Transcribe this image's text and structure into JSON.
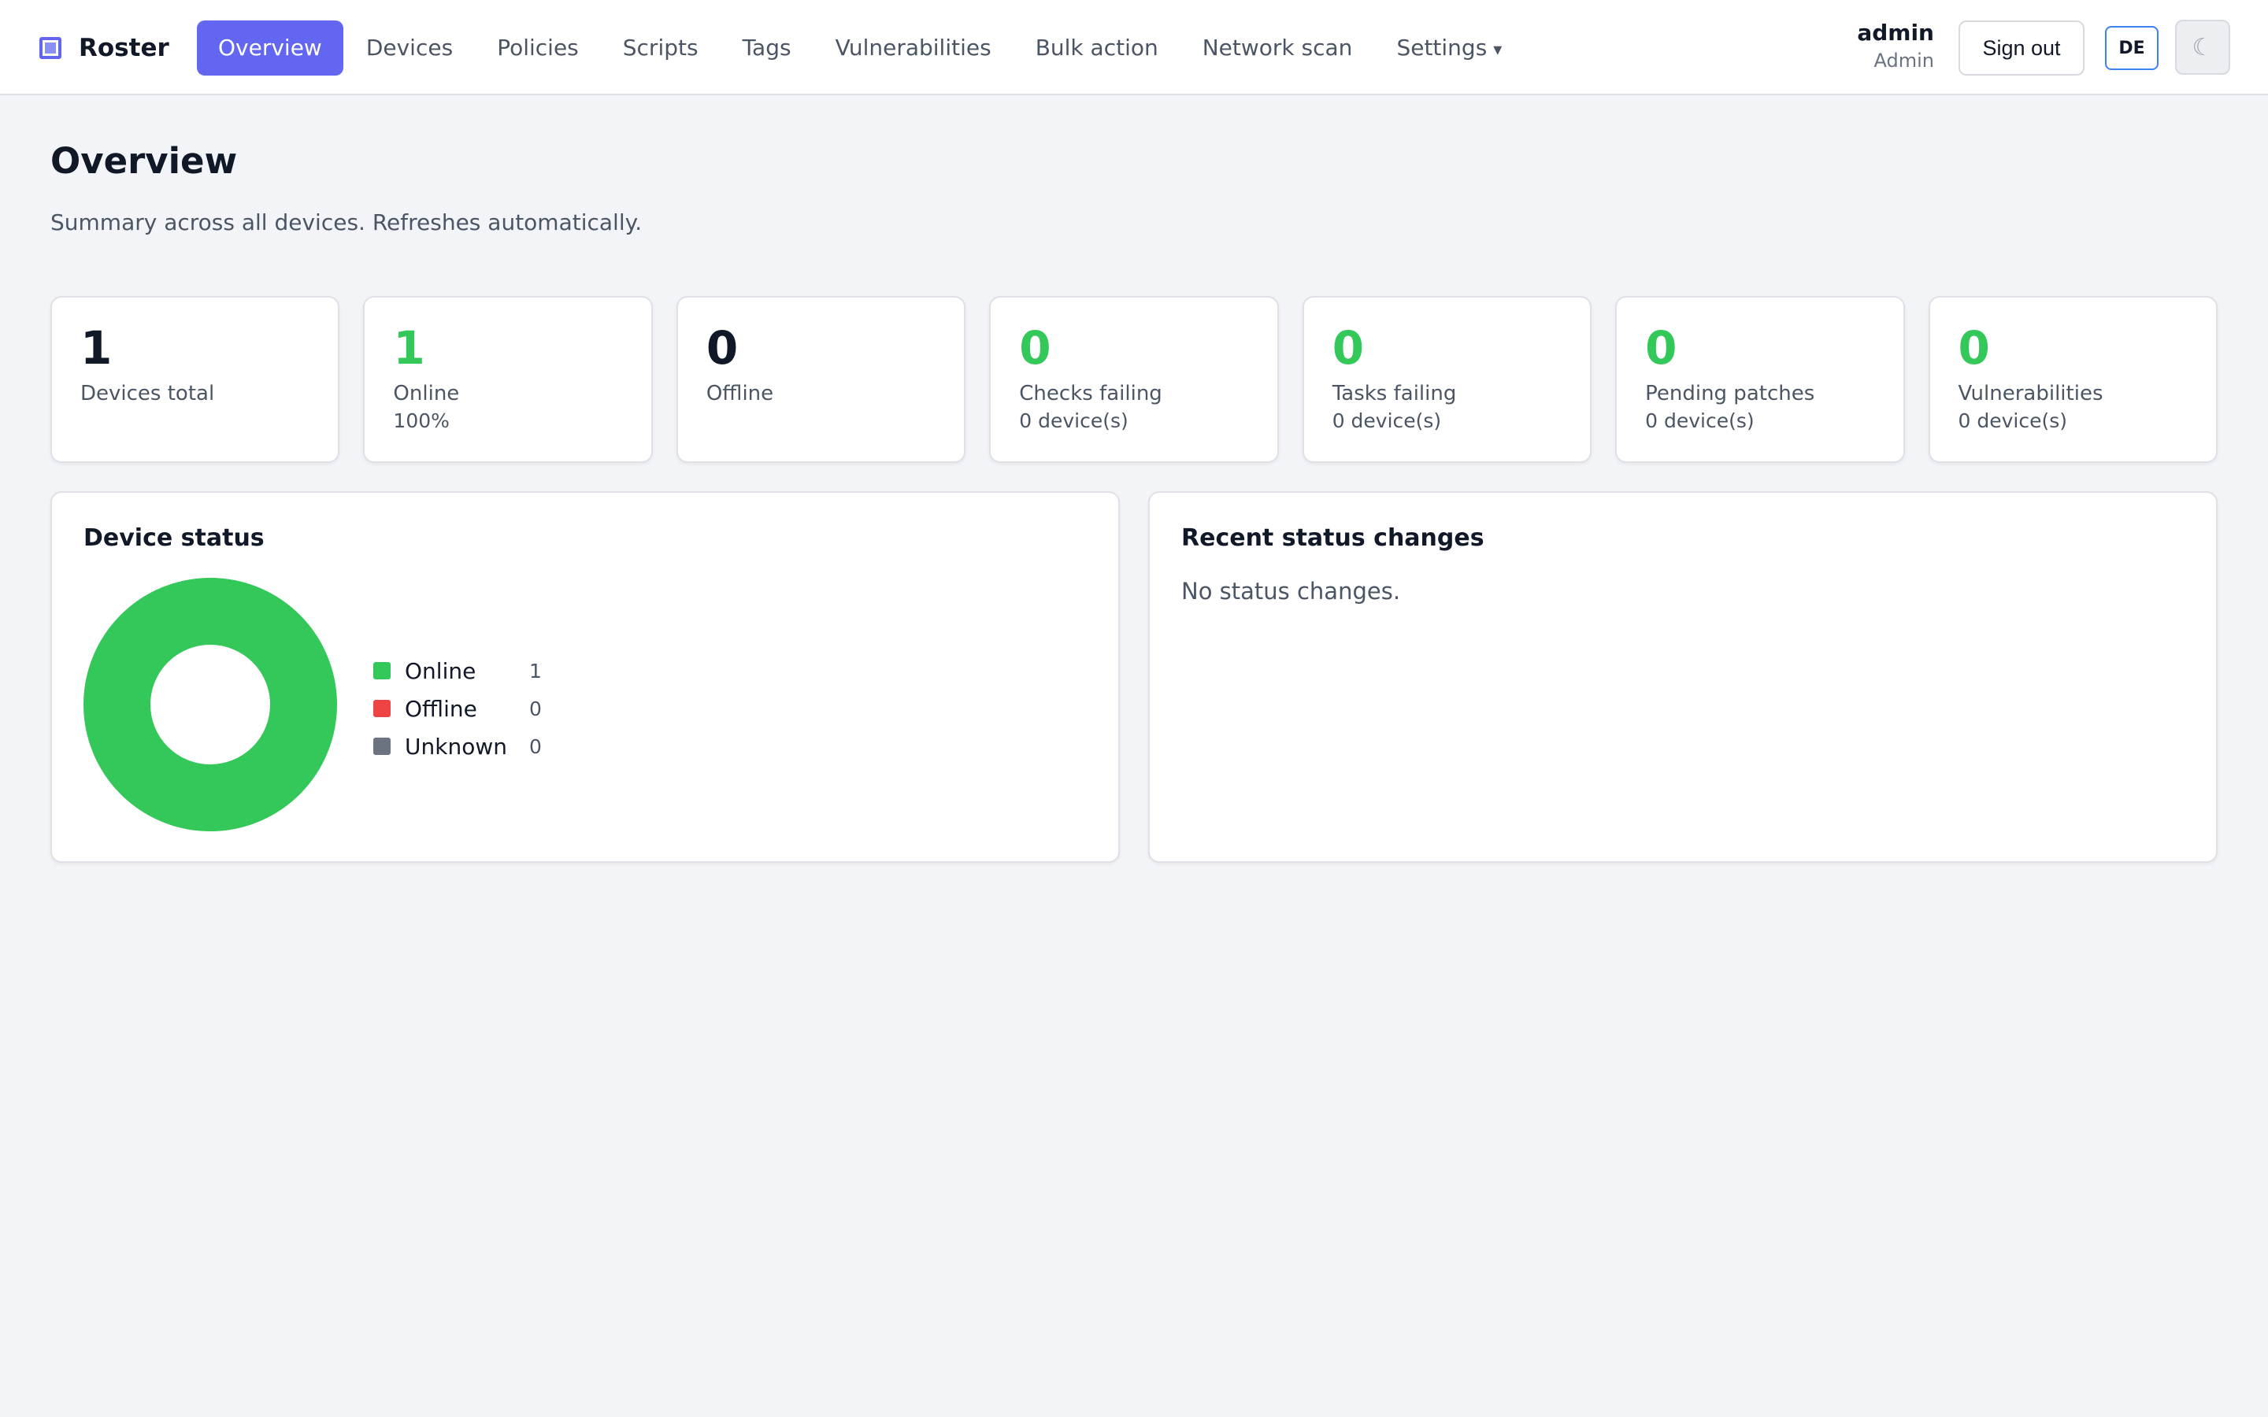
{
  "app": {
    "name": "Roster"
  },
  "nav": {
    "items": [
      {
        "label": "Overview",
        "active": true
      },
      {
        "label": "Devices"
      },
      {
        "label": "Policies"
      },
      {
        "label": "Scripts"
      },
      {
        "label": "Tags"
      },
      {
        "label": "Vulnerabilities"
      },
      {
        "label": "Bulk action"
      },
      {
        "label": "Network scan"
      },
      {
        "label": "Settings",
        "icon": "chevron-down-icon",
        "caret": "▾"
      }
    ]
  },
  "user": {
    "name": "admin",
    "role": "Admin",
    "signout_label": "Sign out",
    "language_label": "DE",
    "theme_icon": "☾"
  },
  "page": {
    "title": "Overview",
    "subtitle": "Summary across all devices. Refreshes automatically."
  },
  "stats": [
    {
      "value": "1",
      "label": "Devices total",
      "sub": "",
      "color": "#111827"
    },
    {
      "value": "1",
      "label": "Online",
      "sub": "100%",
      "color": "#34c759"
    },
    {
      "value": "0",
      "label": "Offline",
      "sub": "",
      "color": "#111827"
    },
    {
      "value": "0",
      "label": "Checks failing",
      "sub": "0 device(s)",
      "color": "#34c759"
    },
    {
      "value": "0",
      "label": "Tasks failing",
      "sub": "0 device(s)",
      "color": "#34c759"
    },
    {
      "value": "0",
      "label": "Pending patches",
      "sub": "0 device(s)",
      "color": "#34c759"
    },
    {
      "value": "0",
      "label": "Vulnerabilities",
      "sub": "0 device(s)",
      "color": "#34c759"
    }
  ],
  "device_status": {
    "title": "Device status",
    "legend": [
      {
        "label": "Online",
        "count": "1",
        "color": "#34c759"
      },
      {
        "label": "Offline",
        "count": "0",
        "color": "#ef4444"
      },
      {
        "label": "Unknown",
        "count": "0",
        "color": "#6b7280"
      }
    ]
  },
  "chart_data": {
    "type": "pie",
    "categories": [
      "Online",
      "Offline",
      "Unknown"
    ],
    "values": [
      1,
      0,
      0
    ],
    "colors": [
      "#34c759",
      "#ef4444",
      "#6b7280"
    ]
  },
  "recent_changes": {
    "title": "Recent status changes",
    "empty_text": "No status changes."
  },
  "colors": {
    "accent": "#6366f1",
    "online": "#34c759",
    "offline": "#ef4444",
    "unknown": "#6b7280"
  }
}
